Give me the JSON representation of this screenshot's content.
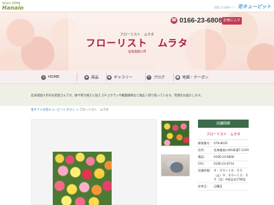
{
  "topbar": {
    "left_logo_line1": "Yahoo! JAPAN",
    "left_logo_line2": "Hanaio",
    "right_logo_small": "花屋さん応援サイト",
    "right_logo": "花キューピット"
  },
  "header": {
    "phone_icon": "phone-icon",
    "phone": "0166-23-6808",
    "favorite_button": "お気に入り",
    "sub_name": "フローリスト　ムラタ",
    "main_name": "フローリスト　ムラタ",
    "area": "北海道旭川市"
  },
  "nav": {
    "items": [
      {
        "icon": "home-icon",
        "label": "HOME"
      },
      {
        "icon": "cart-icon",
        "label": "商品"
      },
      {
        "icon": "camera-icon",
        "label": "ギャラリー"
      },
      {
        "icon": "pen-icon",
        "label": "ブログ"
      },
      {
        "icon": "map-pin-icon",
        "label": "地図・クーポン"
      }
    ]
  },
  "intro": {
    "text": "北海道旭川市のお花屋さんです。鉢や寄せ植えに加えコチョウランや観葉植物など幅広く取り扱っています。笑顔をお届けします。"
  },
  "breadcrumb": {
    "link": "花ギフトの花キューピットタウン",
    "separator": " > ",
    "current": "フローリスト　ムラタ"
  },
  "shop_info": {
    "title": "店舗情報",
    "name": "フローリスト　ムラタ",
    "rows": [
      {
        "label": "郵便番号：",
        "value": "078-8035"
      },
      {
        "label": "住所：",
        "value": "北海道旭川市5条通7-1249"
      },
      {
        "label": "電話：",
        "value": "0166-23-6808"
      },
      {
        "label": "FAX：",
        "value": "0166-23-8714"
      },
      {
        "label": "営業時間：",
        "value": "９：００～１８：００（土）９：００～１２：００（日）※祝日は17時迄"
      },
      {
        "label": "定休日：",
        "value": "日曜日"
      }
    ]
  }
}
